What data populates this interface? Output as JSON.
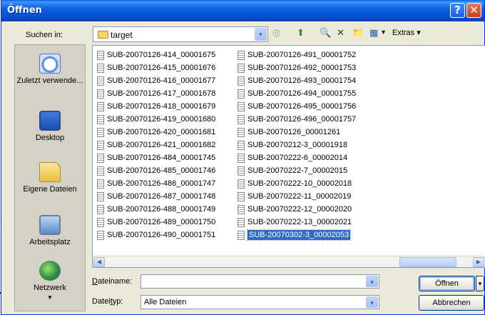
{
  "background": {
    "text_fragment": "f"
  },
  "window": {
    "title": "Öffnen",
    "help_glyph": "?",
    "close_glyph": "✕"
  },
  "look_in": {
    "label": "Suchen in:",
    "value": "target",
    "arrow": "▾"
  },
  "toolbar": {
    "back": "◎",
    "up": "⬆",
    "search": "🔍",
    "delete": "✕",
    "new_folder": "📁",
    "views": "▦",
    "views_arrow": "▾",
    "extras": "Extras ▾"
  },
  "places": [
    {
      "icon": "recent-documents-icon",
      "label": "Zuletzt verwende..."
    },
    {
      "icon": "desktop-icon",
      "label": "Desktop"
    },
    {
      "icon": "my-documents-icon",
      "label": "Eigene Dateien"
    },
    {
      "icon": "my-computer-icon",
      "label": "Arbeitsplatz"
    },
    {
      "icon": "network-icon",
      "label": "Netzwerk"
    }
  ],
  "files": {
    "column1": [
      "SUB-20070126-414_00001675",
      "SUB-20070126-415_00001676",
      "SUB-20070126-416_00001677",
      "SUB-20070126-417_00001678",
      "SUB-20070126-418_00001679",
      "SUB-20070126-419_00001680",
      "SUB-20070126-420_00001681",
      "SUB-20070126-421_00001682",
      "SUB-20070126-484_00001745",
      "SUB-20070126-485_00001746",
      "SUB-20070126-486_00001747",
      "SUB-20070126-487_00001748",
      "SUB-20070126-488_00001749",
      "SUB-20070126-489_00001750",
      "SUB-20070126-490_00001751"
    ],
    "column2": [
      "SUB-20070126-491_00001752",
      "SUB-20070126-492_00001753",
      "SUB-20070126-493_00001754",
      "SUB-20070126-494_00001755",
      "SUB-20070126-495_00001756",
      "SUB-20070126-496_00001757",
      "SUB-20070126_00001261",
      "SUB-20070212-3_00001918",
      "SUB-20070222-6_00002014",
      "SUB-20070222-7_00002015",
      "SUB-20070222-10_00002018",
      "SUB-20070222-11_00002019",
      "SUB-20070222-12_00002020",
      "SUB-20070222-13_00002021",
      "SUB-20070302-3_00002053"
    ],
    "selected": "SUB-20070302-3_00002053"
  },
  "scrollbar": {
    "left": "◀",
    "right": "▶",
    "grip": "|||"
  },
  "filename": {
    "label": "Dateiname:",
    "value": ""
  },
  "filetype": {
    "label": "Dateityp:",
    "value": "Alle Dateien"
  },
  "buttons": {
    "open": "Öffnen",
    "open_arrow": "▾",
    "cancel": "Abbrechen"
  }
}
